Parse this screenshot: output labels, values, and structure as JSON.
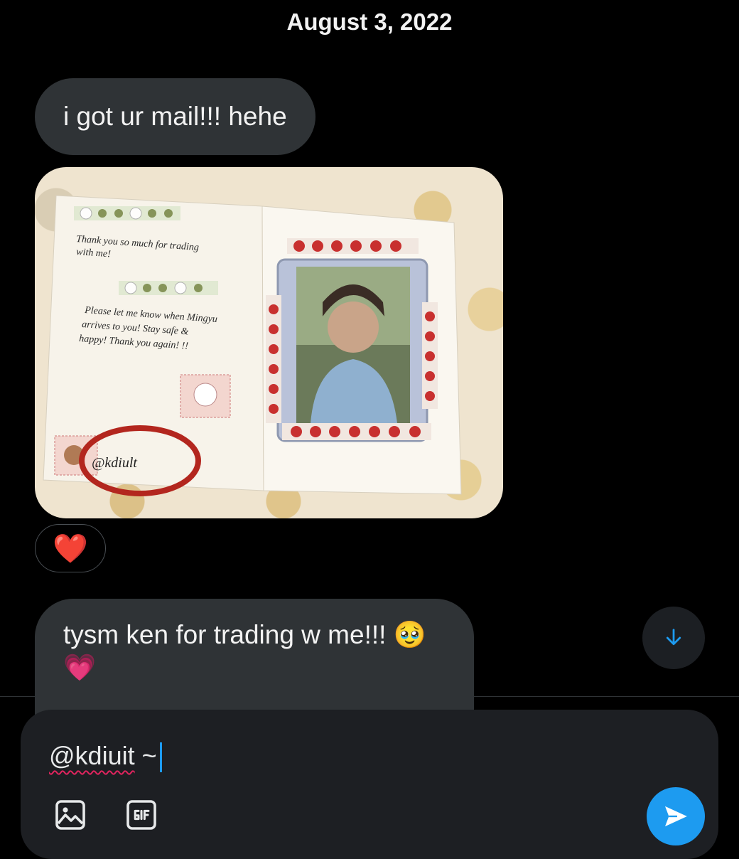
{
  "conversation": {
    "date_header": "August 3, 2022",
    "messages": [
      {
        "text": "i got ur mail!!! hehe"
      },
      {
        "image_description": "photocard-mail"
      },
      {
        "text_line1": "tysm ken for trading w me!!! 🥹",
        "text_line2": "💗"
      }
    ],
    "reaction": "❤️"
  },
  "card": {
    "note_line1": "Thank you so much for trading",
    "note_line2": "with me!",
    "note_line3": "Please let me know when Mingyu",
    "note_line4": "arrives to you! Stay safe &",
    "note_line5": "happy! Thank you again! !!",
    "handle": "@kdiult"
  },
  "composer": {
    "draft_mention": "@kdiuit",
    "draft_suffix": " ~"
  },
  "icons": {
    "scroll": "arrow-down-icon",
    "image": "image-icon",
    "gif": "gif-icon",
    "send": "send-icon"
  },
  "colors": {
    "accent": "#1d9bf0",
    "bubble": "#2f3336",
    "background": "#000000",
    "heart": "#e0245e"
  }
}
